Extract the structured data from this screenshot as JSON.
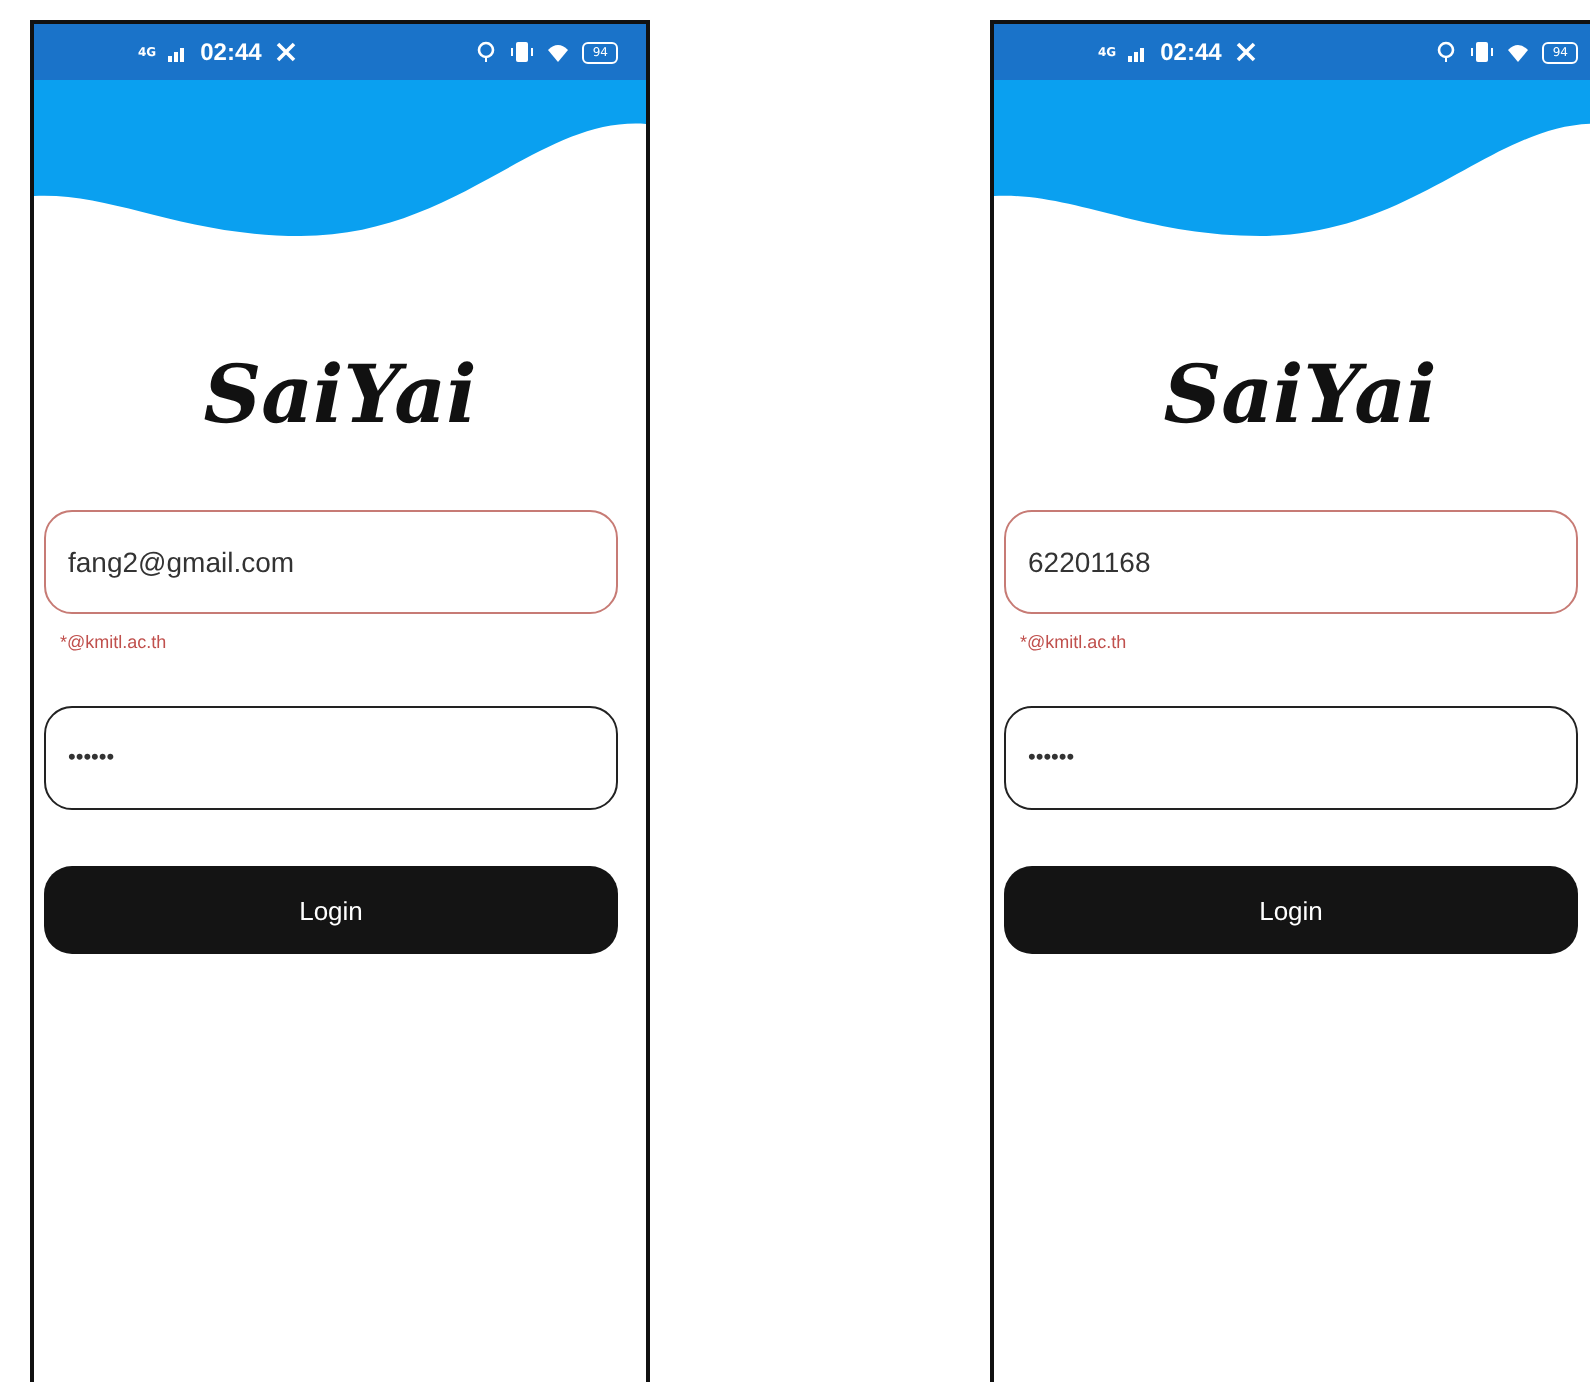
{
  "phones": [
    {
      "status_bar": {
        "network": "4G",
        "time": "02:44",
        "battery": "94"
      },
      "logo": "SaiYai",
      "fields": [
        {
          "kind": "text",
          "value": "fang2@gmail.com",
          "invalid": true,
          "hint": "*@kmitl.ac.th"
        },
        {
          "kind": "password",
          "value": "••••••",
          "invalid": false
        }
      ],
      "button": "Login"
    },
    {
      "status_bar": {
        "network": "4G",
        "time": "02:44",
        "battery": "94"
      },
      "logo": "SaiYai",
      "fields": [
        {
          "kind": "text",
          "value": "62201168",
          "invalid": true,
          "hint": "*@kmitl.ac.th"
        },
        {
          "kind": "password",
          "value": "••••••",
          "invalid": false
        }
      ],
      "button": "Login"
    }
  ]
}
